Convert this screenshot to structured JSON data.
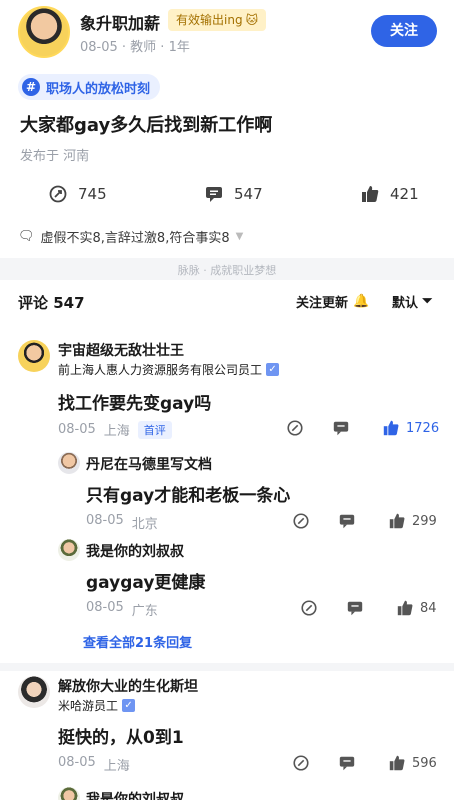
{
  "post": {
    "author_name": "象升职加薪",
    "author_tag": "有效输出ing",
    "author_meta": "08-05 · 教师 · 1年",
    "follow_label": "关注",
    "topic": "职场人的放松时刻",
    "title": "大家都gay多久后找到新工作啊",
    "location": "发布于 河南",
    "stats": {
      "shares": "745",
      "comments": "547",
      "likes": "421"
    },
    "rating": "虚假不实8,言辞过激8,符合事实8",
    "slogan": "脉脉 · 成就职业梦想"
  },
  "comments_header": {
    "title": "评论 547",
    "follow_update": "关注更新",
    "sort_label": "默认"
  },
  "comments": [
    {
      "name": "宇宙超级无敌壮壮王",
      "company": "前上海人惠人力资源服务有限公司员工",
      "text": "找工作要先变gay吗",
      "date": "08-05",
      "location": "上海",
      "badge": "首评",
      "likes": "1726",
      "replies": [
        {
          "name": "丹尼在马德里写文档",
          "text": "只有gay才能和老板一条心",
          "date": "08-05",
          "location": "北京",
          "likes": "299"
        },
        {
          "name": "我是你的刘叔叔",
          "text": "gaygay更健康",
          "date": "08-05",
          "location": "广东",
          "likes": "84"
        }
      ],
      "view_all": "查看全部21条回复"
    },
    {
      "name": "解放你大业的生化斯坦",
      "company": "米哈游员工",
      "text": "挺快的，从0到1",
      "date": "08-05",
      "location": "上海",
      "likes": "596",
      "next_reply_name": "我是你的刘叔叔"
    }
  ],
  "colors": {
    "accent": "#2f64e6",
    "muted": "#9a9fa8",
    "band": "#f4f5f7"
  }
}
